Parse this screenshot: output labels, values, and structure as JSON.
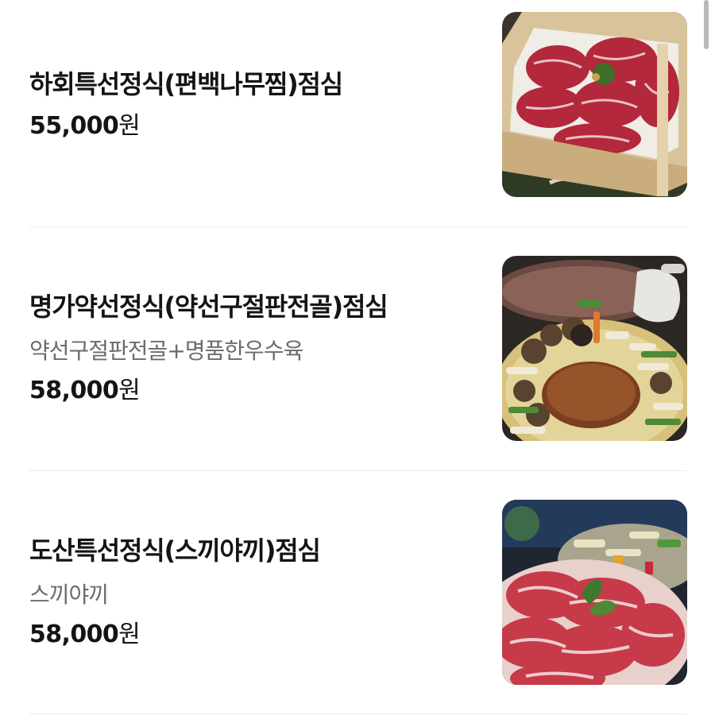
{
  "menu": {
    "currency_suffix": "원",
    "items": [
      {
        "name": "하회특선정식(편백나무찜)점심",
        "description": "",
        "price": "55,000",
        "image": "steamed-beef-cypress-box-photo"
      },
      {
        "name": "명가약선정식(약선구절판전골)점심",
        "description": "약선구절판전골+명품한우수육",
        "price": "58,000",
        "image": "herbal-hotpot-platter-photo"
      },
      {
        "name": "도산특선정식(스끼야끼)점심",
        "description": "스끼야끼",
        "price": "58,000",
        "image": "sukiyaki-beef-platter-photo"
      }
    ]
  }
}
